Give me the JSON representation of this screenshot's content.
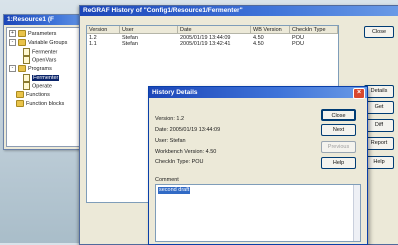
{
  "tree_window": {
    "title": "1:Resource1 (F",
    "items": [
      {
        "label": "Parameters",
        "kind": "folder",
        "toggle": "+"
      },
      {
        "label": "Variable Groups",
        "kind": "folder",
        "toggle": "-"
      },
      {
        "label": "Fermenter",
        "kind": "doc"
      },
      {
        "label": "OpenVars",
        "kind": "doc"
      },
      {
        "label": "Programs",
        "kind": "folder",
        "toggle": "-"
      },
      {
        "label": "Fermenter",
        "kind": "doc",
        "selected": true
      },
      {
        "label": "Operate",
        "kind": "doc"
      },
      {
        "label": "Functions",
        "kind": "folder",
        "toggle": ""
      },
      {
        "label": "Function blocks",
        "kind": "folder",
        "toggle": ""
      }
    ]
  },
  "history_window": {
    "title": "ReGRAF History of \"Config1/Resource1/Fermenter\"",
    "columns": [
      "Version",
      "User",
      "Date",
      "WB Version",
      "CheckIn Type"
    ],
    "rows": [
      [
        "1.2",
        "Stefan",
        "2005/01/19 13:44:09",
        "4.50",
        "POU"
      ],
      [
        "1.1",
        "Stefan",
        "2005/01/19 13:42:41",
        "4.50",
        "POU"
      ]
    ],
    "buttons": {
      "close": "Close",
      "details": "Details",
      "get": "Get",
      "diff": "Diff",
      "report": "Report",
      "help": "Help"
    }
  },
  "details_dialog": {
    "title": "History Details",
    "version": "Version: 1.2",
    "date": "Date: 2005/01/19 13:44:09",
    "user": "User: Stefan",
    "workbench": "Workbench Version: 4.50",
    "checkin": "CheckIn Type: POU",
    "comment_label": "Comment",
    "comment_text": "second draft",
    "buttons": {
      "close": "Close",
      "next": "Next",
      "previous": "Previous",
      "help": "Help"
    }
  },
  "colors": {
    "title_blue": "#1c46b8",
    "selection": "#316ac5",
    "close_red": "#d9482e"
  }
}
